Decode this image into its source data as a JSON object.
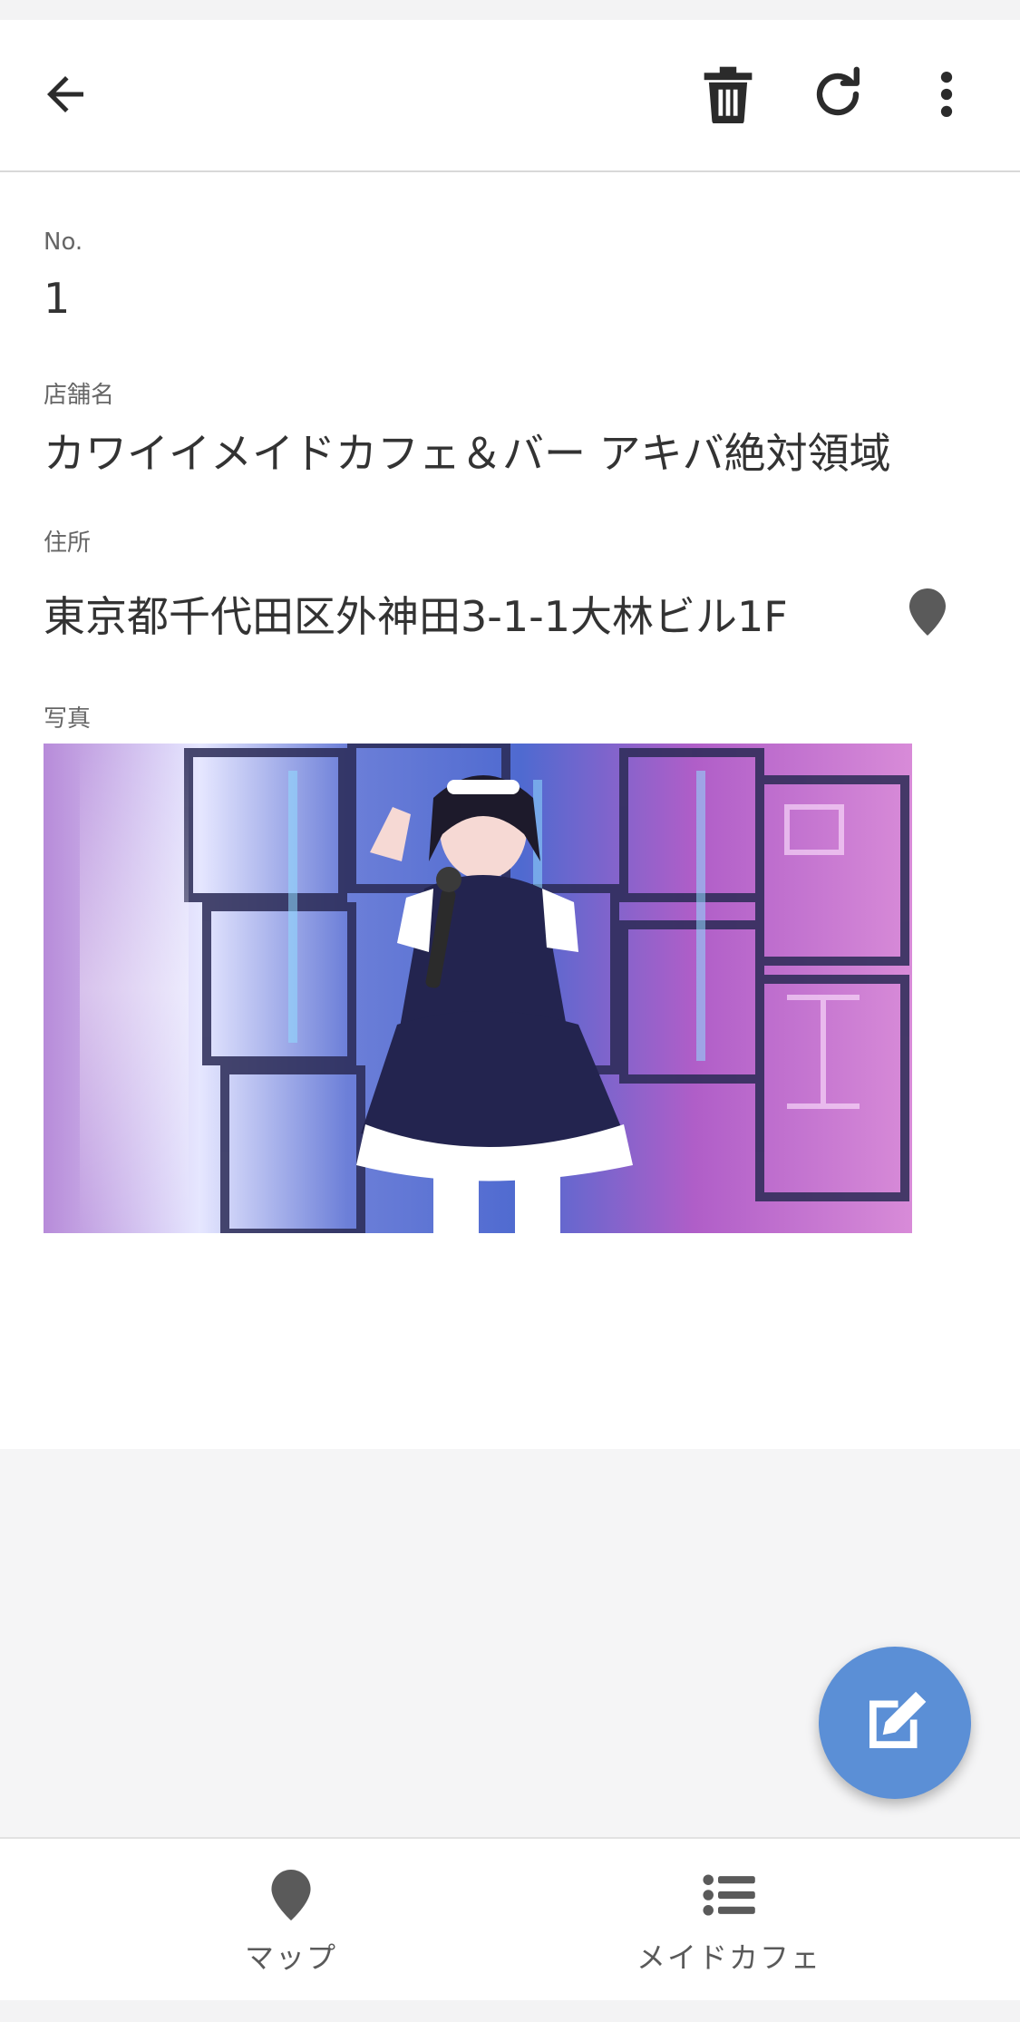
{
  "app_bar": {
    "back_icon": "arrow-left-icon",
    "delete_icon": "trash-icon",
    "refresh_icon": "refresh-icon",
    "more_icon": "more-vertical-icon"
  },
  "record": {
    "no": {
      "label": "No.",
      "value": "1"
    },
    "name": {
      "label": "店舗名",
      "value": "カワイイメイドカフェ＆バー アキバ絶対領域"
    },
    "address": {
      "label": "住所",
      "value": "東京都千代田区外神田3-1-1大林ビル1F",
      "pin_icon": "map-pin-icon"
    },
    "photo": {
      "label": "写真"
    }
  },
  "fab": {
    "icon": "edit-icon"
  },
  "bottom_nav": {
    "items": [
      {
        "label": "マップ",
        "icon": "map-pin-icon"
      },
      {
        "label": "メイドカフェ",
        "icon": "list-icon"
      }
    ]
  },
  "colors": {
    "accent": "#5b8fd6",
    "icon": "#333333",
    "background": "#f5f5f6"
  }
}
